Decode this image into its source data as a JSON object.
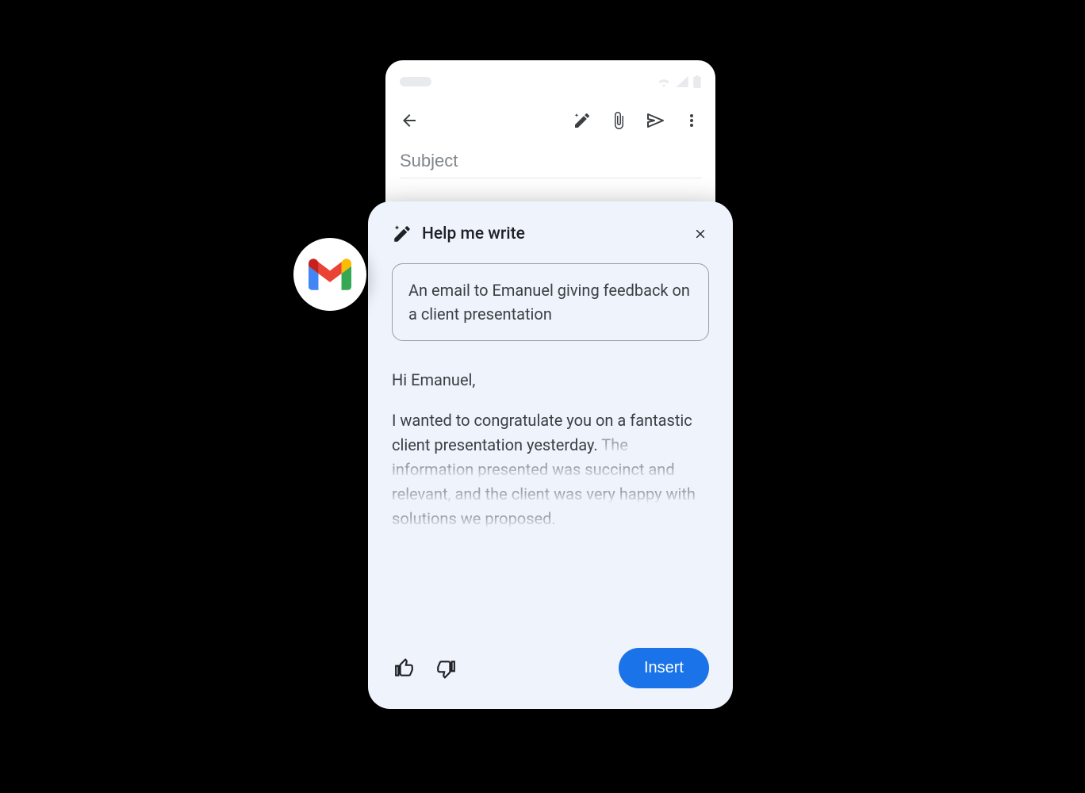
{
  "compose": {
    "subject_placeholder": "Subject"
  },
  "panel": {
    "title": "Help me write",
    "prompt": "An email to Emanuel giving feedback on a client presentation",
    "generated": {
      "greeting": "Hi Emanuel,",
      "body_dark": "I wanted to congratulate you on a fantastic client presentation yesterday.",
      "body_fade": "The information presented was succinct and relevant, and the client was very happy with solutions we proposed."
    },
    "insert_label": "Insert"
  }
}
